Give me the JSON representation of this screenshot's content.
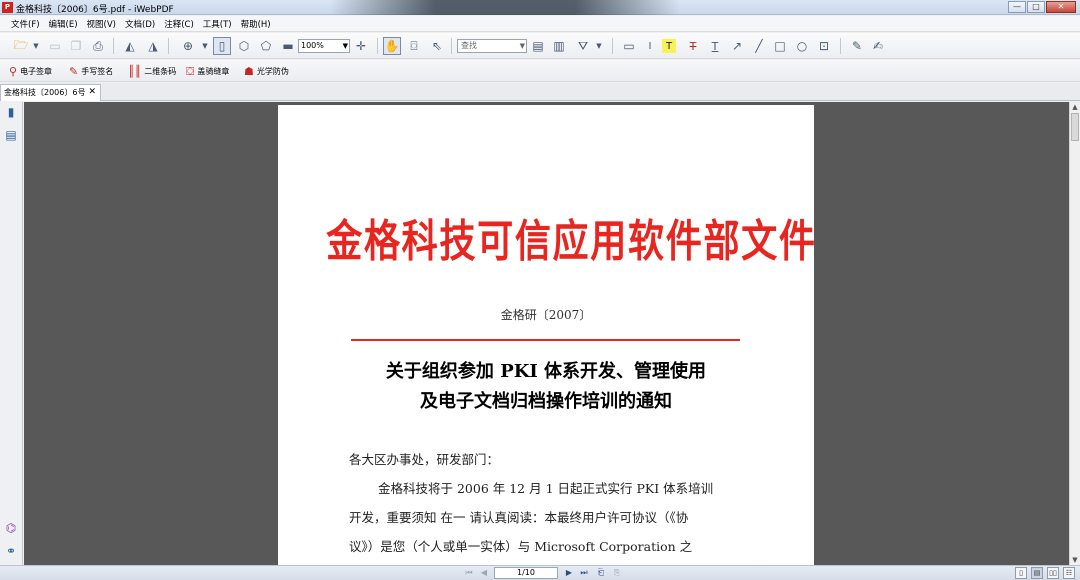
{
  "window": {
    "title": "金格科技〔2006〕6号.pdf - iWebPDF",
    "app_icon_glyph": "P",
    "controls": [
      "—",
      "□",
      "✕"
    ]
  },
  "menu": [
    "文件(F)",
    "编辑(E)",
    "视图(V)",
    "文档(D)",
    "注释(C)",
    "工具(T)",
    "帮助(H)"
  ],
  "toolbar": {
    "zoom_value": "100%",
    "search_placeholder": "查找",
    "icons": [
      "open-folder-icon",
      "dropdown-arrow-icon",
      "save-icon",
      "copy-icon",
      "print-icon",
      "rotate-left-icon",
      "rotate-right-icon",
      "zoom-in-icon",
      "dropdown-arrow-icon",
      "fit-page-icon",
      "fit-width-icon",
      "fit-visible-icon",
      "zoom-out-icon",
      "add-icon",
      "hand-tool-icon",
      "snapshot-icon",
      "select-tool-icon",
      "page-icon",
      "page-text-icon",
      "filter-icon",
      "note-icon",
      "text-cursor-icon",
      "highlight-icon",
      "strikethrough-icon",
      "underline-icon",
      "arrow-icon",
      "line-icon",
      "rectangle-icon",
      "ellipse-icon",
      "stamp-icon",
      "edit-icon",
      "sign-edit-icon"
    ]
  },
  "toolbar2": {
    "items": [
      {
        "label": "电子签章",
        "icon": "seal-stamp-icon"
      },
      {
        "label": "手写签名",
        "icon": "pen-icon"
      },
      {
        "label": "二维条码",
        "icon": "barcode-icon"
      },
      {
        "label": "盖骑缝章",
        "icon": "cross-page-seal-icon"
      },
      {
        "label": "光学防伪",
        "icon": "optical-security-icon"
      }
    ]
  },
  "tabs": [
    {
      "label": "金格科技〔2006〕6号",
      "close": "✕"
    }
  ],
  "document": {
    "red_header": "金格科技可信应用软件部文件",
    "doc_number": "金格研〔2007〕",
    "heading_line1": "关于组织参加 PKI 体系开发、管理使用",
    "heading_line2": "及电子文档归档操作培训的通知",
    "salutation": "各大区办事处，研发部门：",
    "paragraph_line1": "金格科技将于 2006 年 12 月 1 日起正式实行 PKI 体系培训",
    "paragraph_line2": "开发，重要须知 在一 请认真阅读：本最终用户许可协议（《协",
    "paragraph_line3": "议》）是您（个人或单一实体）与 Microsoft Corporation 之"
  },
  "status": {
    "page_indicator": "1/10"
  },
  "colors": {
    "header_red": "#e8251f",
    "viewer_bg": "#585858"
  }
}
